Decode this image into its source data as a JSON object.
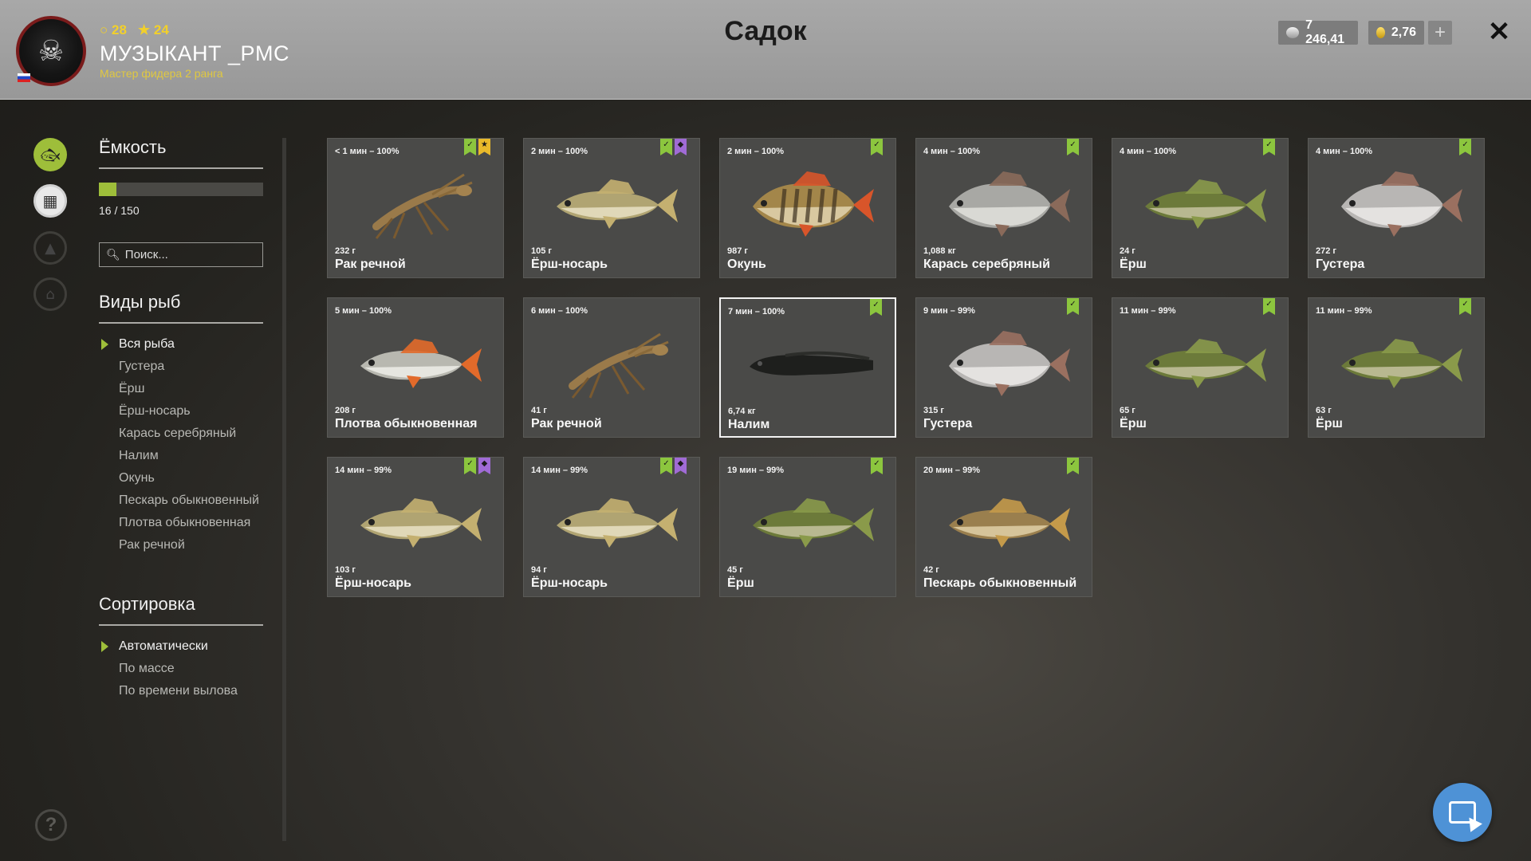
{
  "header": {
    "title": "Садок",
    "player_name": "МУЗЫКАНТ _PMC",
    "player_rank": "Мастер фидера 2 ранга",
    "stat_level": "28",
    "stat_stars": "24",
    "silver": "7 246,41",
    "gold": "2,76",
    "avatar_icon": "skull-emblem-icon",
    "flag_icon": "russia-flag-icon"
  },
  "rail": {
    "items": [
      {
        "icon": "fish-icon",
        "active": true
      },
      {
        "icon": "keepnet-icon",
        "active": true
      },
      {
        "icon": "campfire-icon",
        "active": false
      },
      {
        "icon": "house-icon",
        "active": false
      }
    ],
    "help_icon": "question-icon"
  },
  "capacity": {
    "title": "Ёмкость",
    "used": 16,
    "max": 150,
    "label": "16 / 150"
  },
  "search": {
    "placeholder": "Поиск..."
  },
  "species": {
    "title": "Виды рыб",
    "items": [
      "Вся рыба",
      "Густера",
      "Ёрш",
      "Ёрш-носарь",
      "Карась серебряный",
      "Налим",
      "Окунь",
      "Пескарь обыкновенный",
      "Плотва обыкновенная",
      "Рак речной"
    ],
    "selected": "Вся рыба"
  },
  "sort": {
    "title": "Сортировка",
    "items": [
      "Автоматически",
      "По массе",
      "По времени вылова"
    ],
    "selected": "Автоматически"
  },
  "catches": [
    {
      "time": "< 1 мин – 100%",
      "weight": "232 г",
      "name": "Рак речной",
      "kind": "crayfish",
      "badges": [
        "green",
        "yellow"
      ]
    },
    {
      "time": "2 мин – 100%",
      "weight": "105 г",
      "name": "Ёрш-носарь",
      "kind": "ruffe-long",
      "badges": [
        "green",
        "purple"
      ]
    },
    {
      "time": "2 мин – 100%",
      "weight": "987 г",
      "name": "Окунь",
      "kind": "perch",
      "badges": [
        "green"
      ]
    },
    {
      "time": "4 мин – 100%",
      "weight": "1,088 кг",
      "name": "Карась серебряный",
      "kind": "carp",
      "badges": [
        "green"
      ]
    },
    {
      "time": "4 мин – 100%",
      "weight": "24 г",
      "name": "Ёрш",
      "kind": "ruffe",
      "badges": [
        "green"
      ]
    },
    {
      "time": "4 мин – 100%",
      "weight": "272 г",
      "name": "Густера",
      "kind": "bream",
      "badges": [
        "green"
      ]
    },
    {
      "time": "5 мин – 100%",
      "weight": "208 г",
      "name": "Плотва обыкновенная",
      "kind": "roach",
      "badges": []
    },
    {
      "time": "6 мин – 100%",
      "weight": "41 г",
      "name": "Рак речной",
      "kind": "crayfish",
      "badges": []
    },
    {
      "time": "7 мин – 100%",
      "weight": "6,74 кг",
      "name": "Налим",
      "kind": "burbot",
      "badges": [
        "green"
      ],
      "selected": true
    },
    {
      "time": "9 мин – 99%",
      "weight": "315 г",
      "name": "Густера",
      "kind": "bream",
      "badges": [
        "green"
      ]
    },
    {
      "time": "11 мин – 99%",
      "weight": "65 г",
      "name": "Ёрш",
      "kind": "ruffe",
      "badges": [
        "green"
      ]
    },
    {
      "time": "11 мин – 99%",
      "weight": "63 г",
      "name": "Ёрш",
      "kind": "ruffe",
      "badges": [
        "green"
      ]
    },
    {
      "time": "14 мин – 99%",
      "weight": "103 г",
      "name": "Ёрш-носарь",
      "kind": "ruffe-long",
      "badges": [
        "green",
        "purple"
      ]
    },
    {
      "time": "14 мин – 99%",
      "weight": "94 г",
      "name": "Ёрш-носарь",
      "kind": "ruffe-long",
      "badges": [
        "green",
        "purple"
      ]
    },
    {
      "time": "19 мин – 99%",
      "weight": "45 г",
      "name": "Ёрш",
      "kind": "ruffe",
      "badges": [
        "green"
      ]
    },
    {
      "time": "20 мин – 99%",
      "weight": "42 г",
      "name": "Пескарь обыкновенный",
      "kind": "gudgeon",
      "badges": [
        "green"
      ]
    }
  ],
  "colors": {
    "accent_green": "#9ebe3a",
    "badge_green": "#8cc63e",
    "badge_yellow": "#e9b92a",
    "badge_purple": "#a06bd6",
    "gold_text": "#f2d02a",
    "fab_blue": "#4e92d6"
  },
  "fab": {
    "icon": "cursor-window-icon"
  }
}
